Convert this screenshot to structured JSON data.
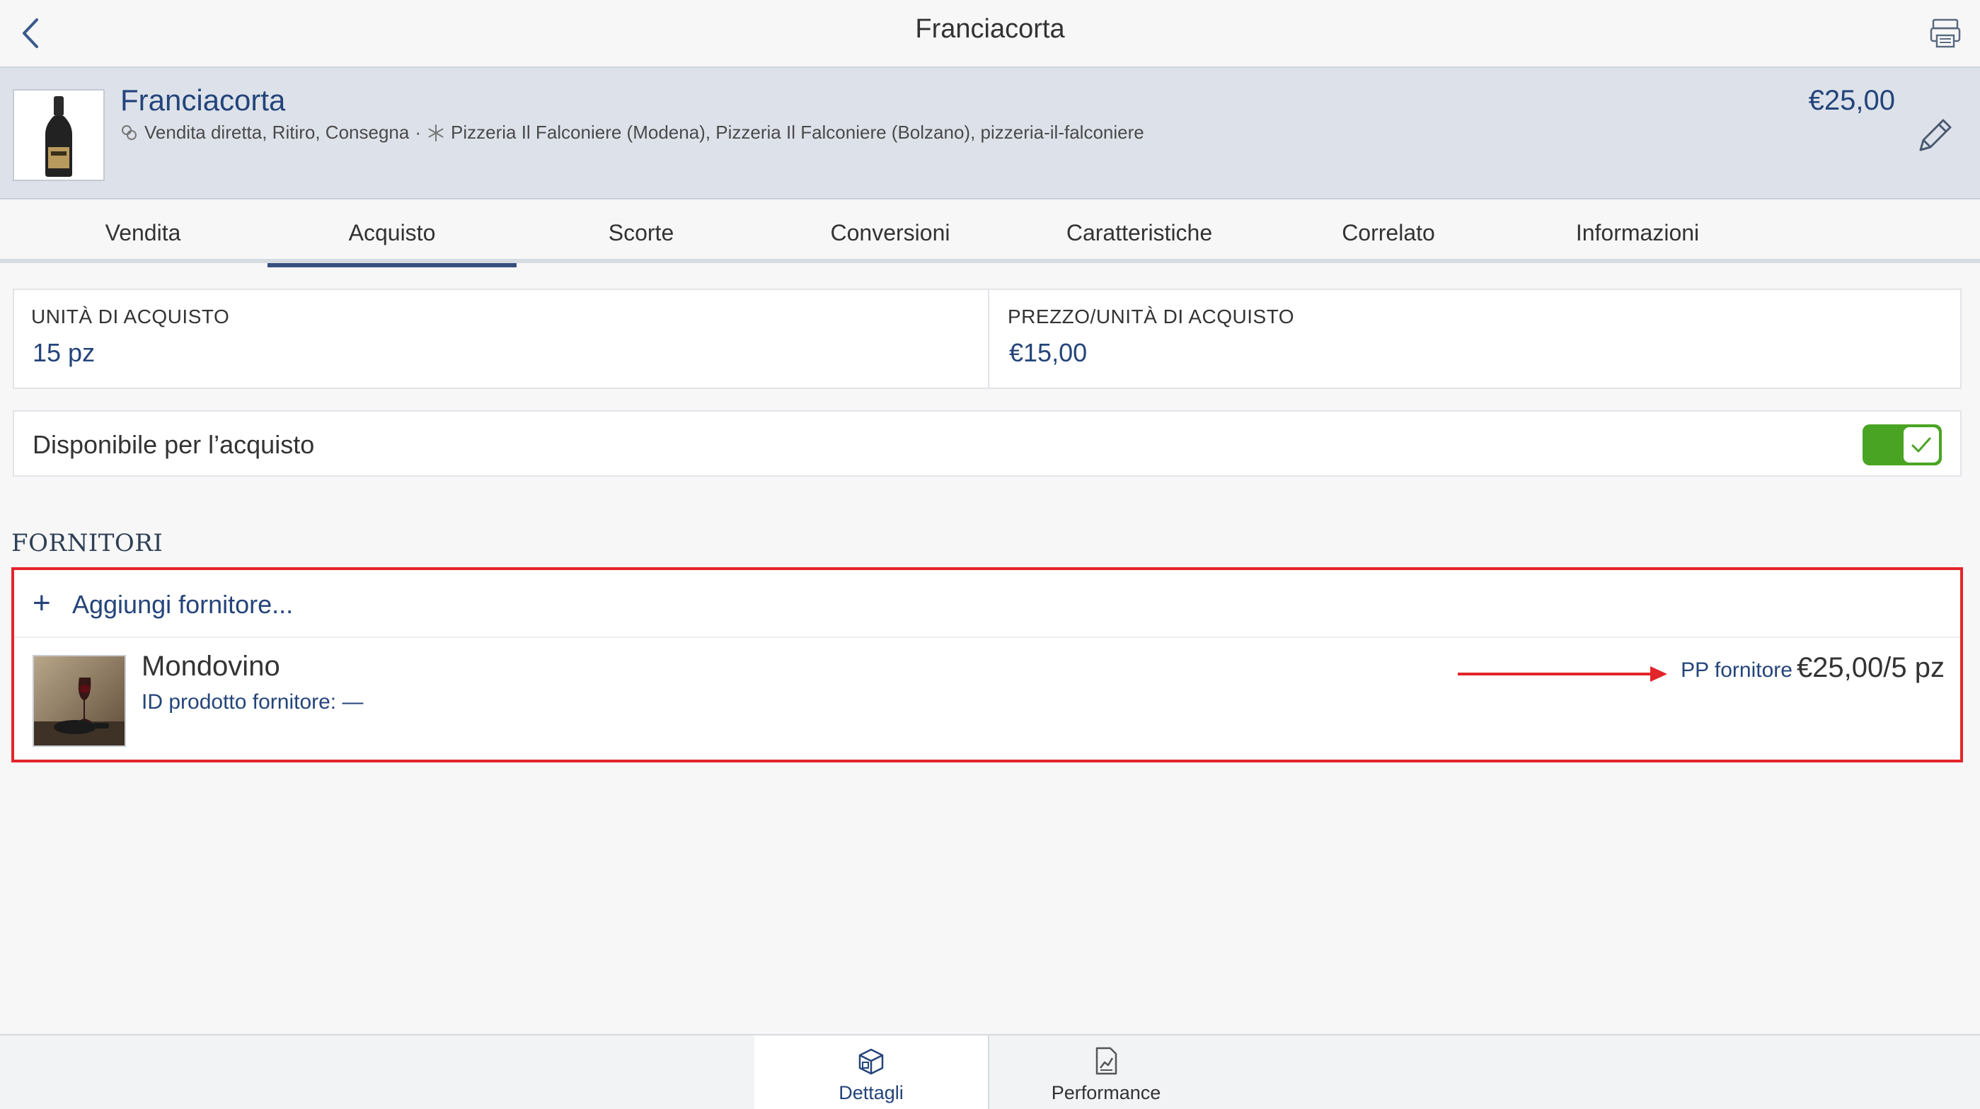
{
  "nav": {
    "title": "Franciacorta",
    "back_icon": "chevron-left-icon",
    "printer_icon": "printer-icon"
  },
  "product": {
    "name": "Franciacorta",
    "sales_modes": "Vendita diretta, Ritiro, Consegna",
    "separator": "·",
    "locations": "Pizzeria Il Falconiere (Modena), Pizzeria Il Falconiere (Bolzano), pizzeria-il-falconiere",
    "price": "€25,00",
    "edit_icon": "pencil-icon"
  },
  "tabs": [
    {
      "label": "Vendita",
      "active": false
    },
    {
      "label": "Acquisto",
      "active": true
    },
    {
      "label": "Scorte",
      "active": false
    },
    {
      "label": "Conversioni",
      "active": false
    },
    {
      "label": "Caratteristiche",
      "active": false
    },
    {
      "label": "Correlato",
      "active": false
    },
    {
      "label": "Informazioni",
      "active": false
    }
  ],
  "purchase": {
    "unit_label": "UNITÀ DI ACQUISTO",
    "unit_value": "15 pz",
    "price_label": "PREZZO/UNITÀ DI ACQUISTO",
    "price_value": "€15,00"
  },
  "availability": {
    "label": "Disponibile per l’acquisto",
    "enabled": true
  },
  "suppliers": {
    "section_title": "FORNITORI",
    "add_plus": "+",
    "add_label": "Aggiungi fornitore...",
    "items": [
      {
        "name": "Mondovino",
        "product_id": "ID prodotto fornitore: —",
        "price_prefix": "PP fornitore",
        "price": "€25,00/5 pz"
      }
    ]
  },
  "bottom_tabs": [
    {
      "label": "Dettagli",
      "icon": "box-icon",
      "active": true
    },
    {
      "label": "Performance",
      "icon": "chart-document-icon",
      "active": false
    }
  ],
  "colors": {
    "accent": "#24447a",
    "toggle_on": "#4aa423",
    "highlight": "#e3252a"
  }
}
